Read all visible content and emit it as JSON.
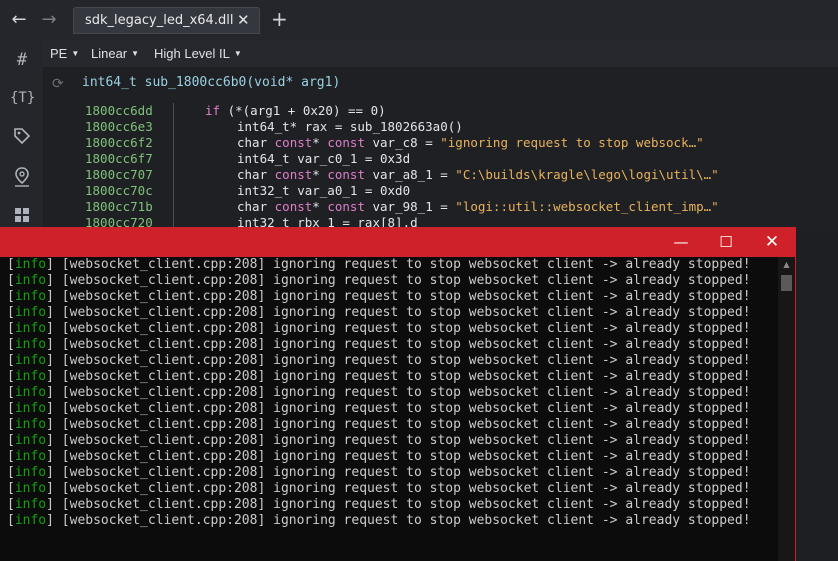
{
  "tab": {
    "title": "sdk_legacy_led_x64.dll"
  },
  "icons": {
    "back": "arrow-left-icon",
    "forward": "arrow-right-icon",
    "new_tab": "plus-icon",
    "close_tab": "close-icon"
  },
  "viewbar": {
    "pe": "PE",
    "linear": "Linear",
    "il": "High Level IL"
  },
  "code": {
    "signature": "int64_t sub_1800cc6b0(void* arg1)",
    "lines": [
      {
        "addr": "1800cc6dd",
        "text": "if (*(arg1 + 0x20) == 0)"
      },
      {
        "addr": "1800cc6e3",
        "text": "int64_t* rax = sub_1802663a0()"
      },
      {
        "addr": "1800cc6f2",
        "text": "char const* const var_c8 = \"ignoring request to stop websock…\""
      },
      {
        "addr": "1800cc6f7",
        "text": "int64_t var_c0_1 = 0x3d"
      },
      {
        "addr": "1800cc707",
        "text": "char const* const var_a8_1 = \"C:\\builds\\kragle\\lego\\logi\\util\\…\""
      },
      {
        "addr": "1800cc70c",
        "text": "int32_t var_a0_1 = 0xd0"
      },
      {
        "addr": "1800cc71b",
        "text": "char const* const var_98_1 = \"logi::util::websocket_client_imp…\""
      },
      {
        "addr": "1800cc720",
        "text": "int32_t rbx_1 = rax[8].d"
      }
    ]
  },
  "console": {
    "buttons": {
      "minimize": "—",
      "maximize": "☐",
      "close": "✕"
    },
    "level": "info",
    "source": "[websocket_client.cpp:208]",
    "message": "ignoring request to stop websocket client -> already stopped!",
    "line_count": 17
  },
  "colors": {
    "console_title": "#cf2129",
    "log_level": "#13a10e",
    "address": "#7fc27a",
    "string": "#e8b25c",
    "keyword": "#e07ec8"
  }
}
